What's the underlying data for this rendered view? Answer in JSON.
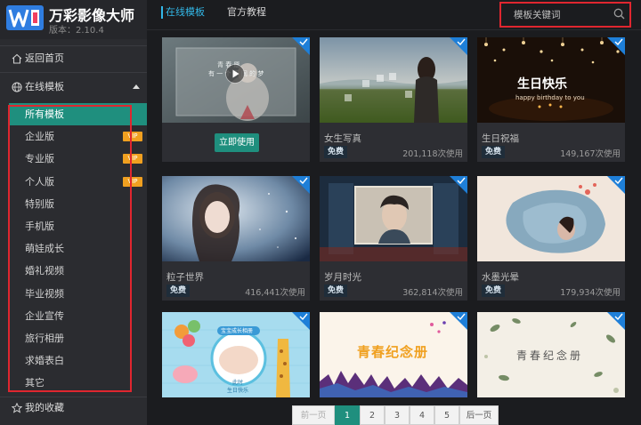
{
  "app": {
    "name": "万彩影像大师",
    "version": "版本：2.10.4"
  },
  "nav": {
    "home": "返回首页",
    "online_templates": "在线模板",
    "favorites": "我的收藏"
  },
  "categories": [
    {
      "label": "所有模板",
      "active": true,
      "vip": false
    },
    {
      "label": "企业版",
      "active": false,
      "vip": true
    },
    {
      "label": "专业版",
      "active": false,
      "vip": true
    },
    {
      "label": "个人版",
      "active": false,
      "vip": true
    },
    {
      "label": "特别版",
      "active": false,
      "vip": false
    },
    {
      "label": "手机版",
      "active": false,
      "vip": false
    },
    {
      "label": "萌娃成长",
      "active": false,
      "vip": false
    },
    {
      "label": "婚礼视频",
      "active": false,
      "vip": false
    },
    {
      "label": "毕业视频",
      "active": false,
      "vip": false
    },
    {
      "label": "企业宣传",
      "active": false,
      "vip": false
    },
    {
      "label": "旅行相册",
      "active": false,
      "vip": false
    },
    {
      "label": "求婚表白",
      "active": false,
      "vip": false
    },
    {
      "label": "其它",
      "active": false,
      "vip": false
    }
  ],
  "vip_tag": "VIP",
  "tabs": {
    "online": "在线模板",
    "official": "官方教程"
  },
  "search": {
    "placeholder": "模板关键词"
  },
  "card1": {
    "use_now": "立即使用",
    "thumb_text_line1": "青 春 愿",
    "thumb_text_line2": "有 一 个 不 同 的 梦"
  },
  "cards": [
    {
      "title": "女生写真",
      "badge": "免费",
      "count": "201,118次使用"
    },
    {
      "title": "生日祝福",
      "badge": "免费",
      "count": "149,167次使用",
      "thumb_title": "生日快乐",
      "thumb_sub": "happy birthday to you"
    },
    {
      "title": "粒子世界",
      "badge": "免费",
      "count": "416,441次使用"
    },
    {
      "title": "岁月时光",
      "badge": "免费",
      "count": "362,814次使用"
    },
    {
      "title": "水墨光晕",
      "badge": "免费",
      "count": "179,934次使用"
    }
  ],
  "row3": {
    "baby_line1": "宝宝成长相册",
    "baby_line2": "此时",
    "baby_line3": "生日快乐",
    "youth": "青春纪念册",
    "ink": "青春纪念册"
  },
  "pager": {
    "prev": "前一页",
    "pages": [
      "1",
      "2",
      "3",
      "4",
      "5"
    ],
    "next": "后一页",
    "current": "1"
  },
  "colors": {
    "accent": "#1f8f7e",
    "tab_active": "#33b8e8",
    "highlight": "#e0262f",
    "check": "#1e7fd8",
    "vip": "#f0a020"
  }
}
